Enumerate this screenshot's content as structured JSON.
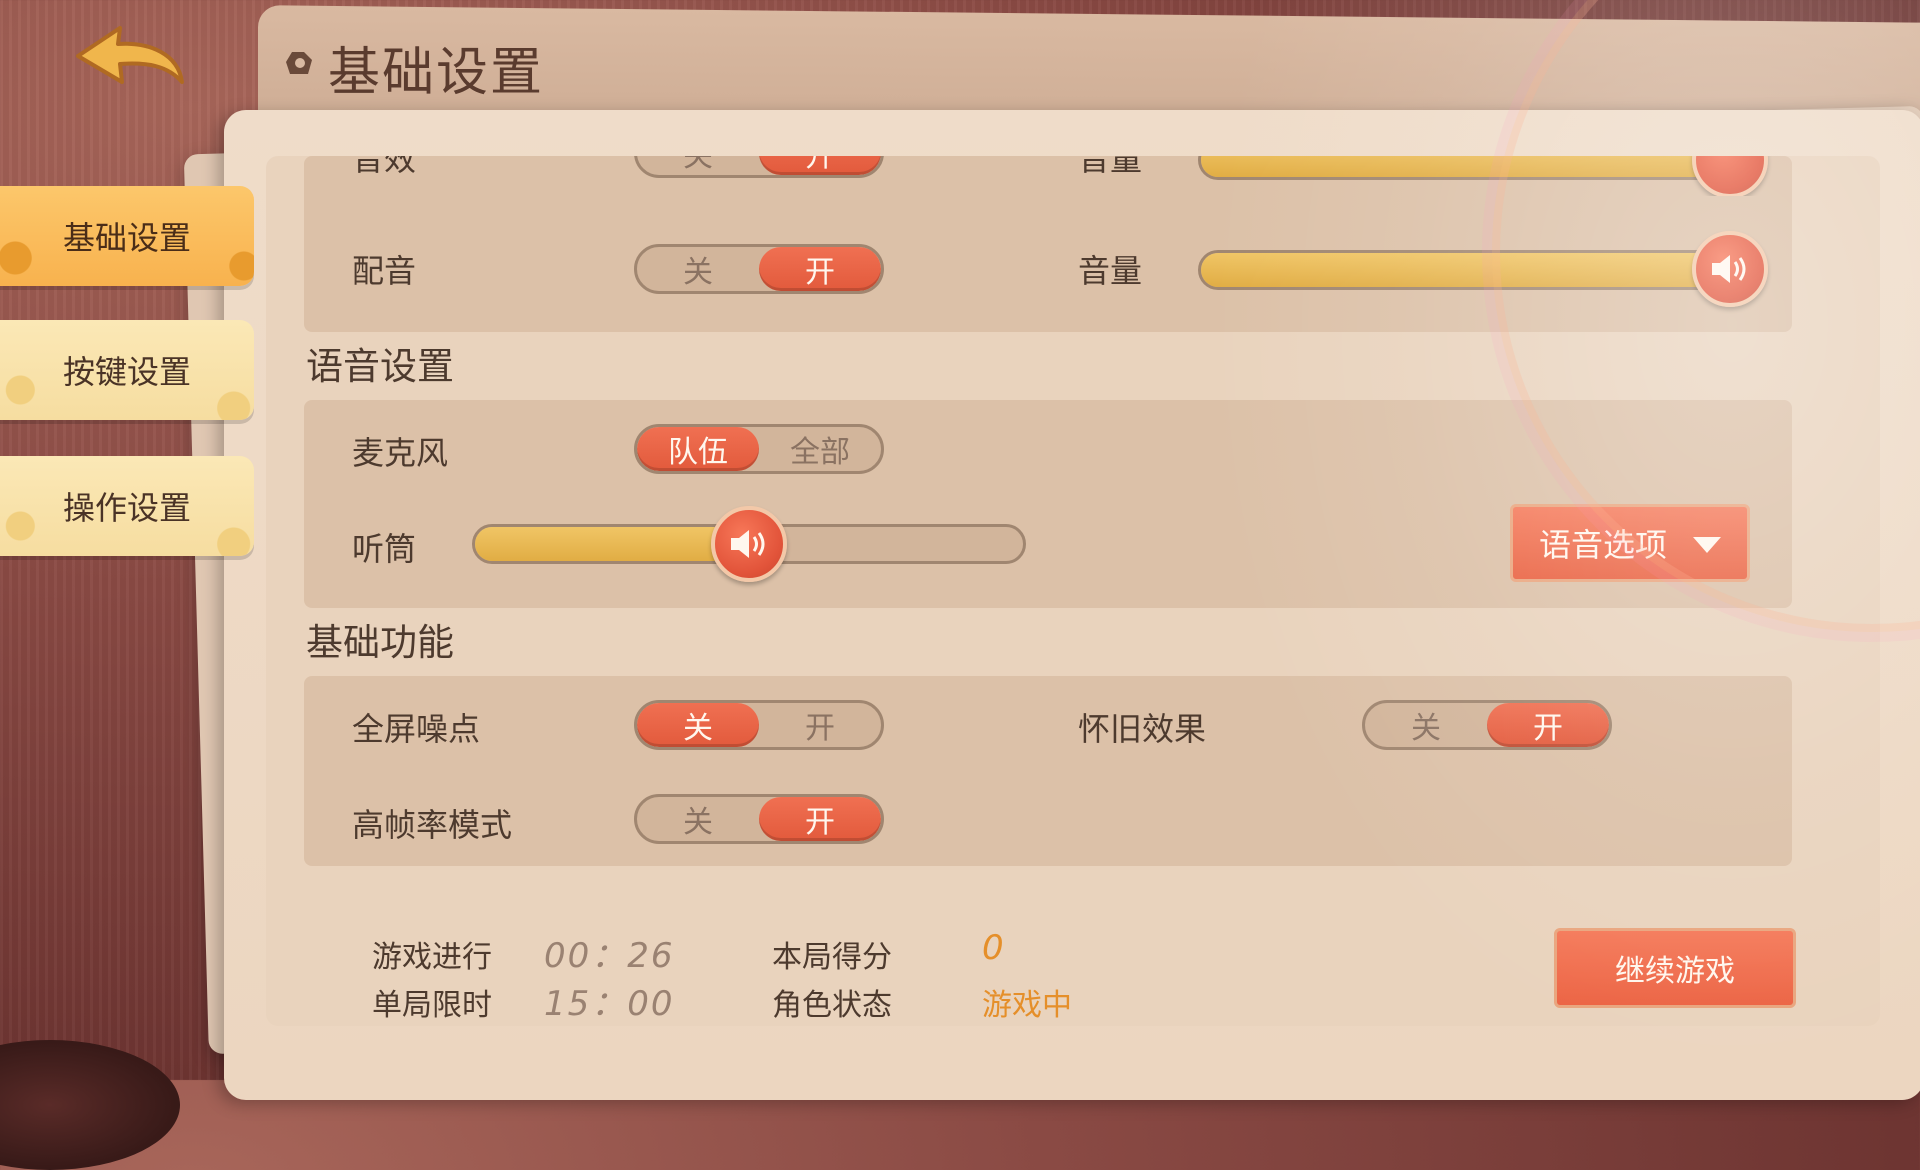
{
  "header": {
    "title": "基础设置"
  },
  "sidebar": {
    "items": [
      {
        "label": "基础设置"
      },
      {
        "label": "按键设置"
      },
      {
        "label": "操作设置"
      }
    ]
  },
  "sound": {
    "row1": {
      "label": "音效",
      "off": "关",
      "on": "开",
      "volume_label": "音量",
      "volume": 1.0
    },
    "row2": {
      "label": "配音",
      "off": "关",
      "on": "开",
      "volume_label": "音量",
      "volume": 1.0
    }
  },
  "voice": {
    "title": "语音设置",
    "mic": {
      "label": "麦克风",
      "team": "队伍",
      "all": "全部",
      "selected": "队伍"
    },
    "earpiece": {
      "label": "听筒",
      "volume": 0.5
    },
    "options_button": "语音选项"
  },
  "basic": {
    "title": "基础功能",
    "noise": {
      "label": "全屏噪点",
      "off": "关",
      "on": "开",
      "state": "关"
    },
    "retro": {
      "label": "怀旧效果",
      "off": "关",
      "on": "开",
      "state": "开"
    },
    "hfr": {
      "label": "高帧率模式",
      "off": "关",
      "on": "开",
      "state": "开"
    }
  },
  "stats": {
    "elapsed_label": "游戏进行",
    "elapsed": "00：26",
    "limit_label": "单局限时",
    "limit": "15：00",
    "score_label": "本局得分",
    "score": "0",
    "role_label": "角色状态",
    "role": "游戏中"
  },
  "continue_button": "继续游戏",
  "colors": {
    "accent": "#e9603f",
    "tab_active": "#f8b24e",
    "slider_fill": "#e1ad44"
  }
}
